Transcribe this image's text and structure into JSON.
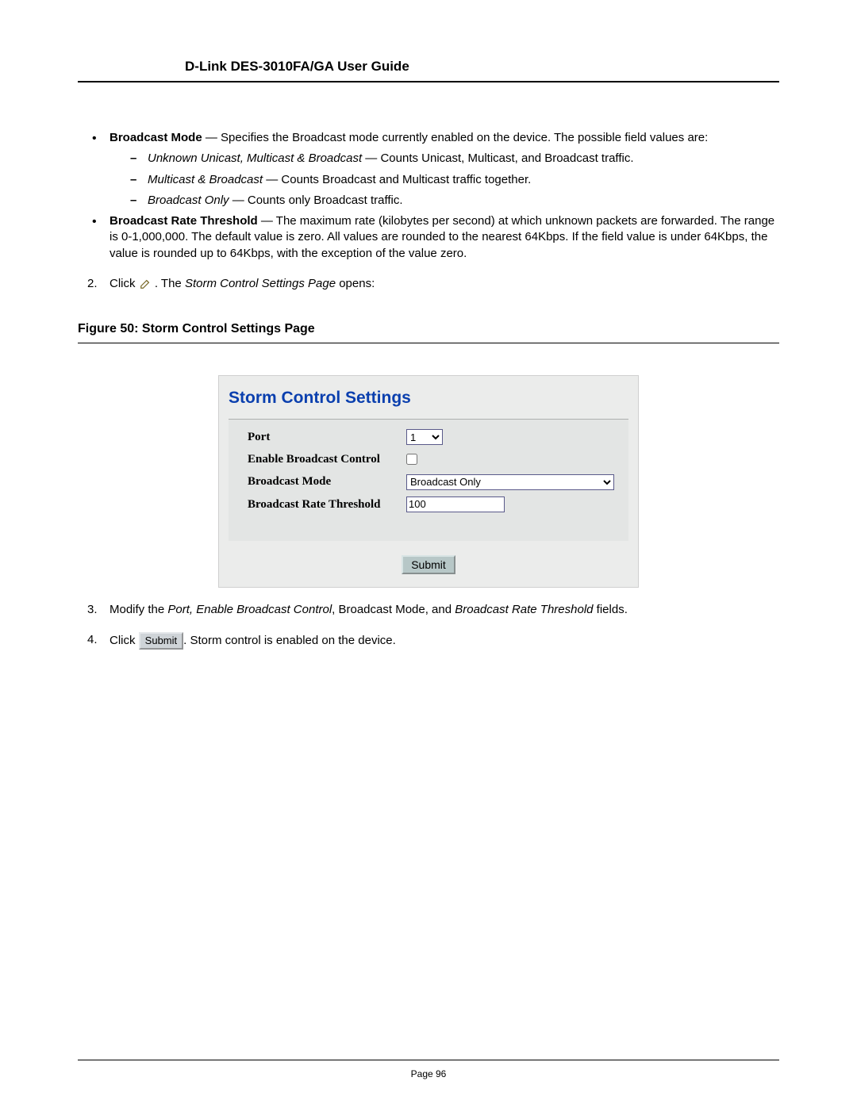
{
  "header": {
    "title": "D-Link DES-3010FA/GA User Guide"
  },
  "bullets": {
    "bm_label": "Broadcast Mode",
    "bm_desc": " — Specifies the Broadcast mode currently enabled on the device. The possible field values are:",
    "sub": [
      {
        "em": "Unknown Unicast, Multicast & Broadcast",
        "rest": " — Counts Unicast, Multicast, and Broadcast traffic."
      },
      {
        "em": "Multicast & Broadcast",
        "rest": " — Counts Broadcast and Multicast traffic together."
      },
      {
        "em": "Broadcast Only",
        "rest": " — Counts only Broadcast traffic."
      }
    ],
    "brt_label": "Broadcast Rate Threshold",
    "brt_desc": " — The maximum rate (kilobytes per second) at which unknown packets are forwarded. The range is 0-1,000,000. The default value is zero. All values are rounded to the nearest 64Kbps. If the field value is under 64Kbps, the value is rounded up to 64Kbps, with the exception of the value zero."
  },
  "step2": {
    "num": "2.",
    "pre": "Click ",
    "mid_em": "Storm Control Settings Page",
    "post": " opens:"
  },
  "figure": {
    "caption": "Figure 50:  Storm Control Settings Page"
  },
  "ui": {
    "title": "Storm Control Settings",
    "rows": {
      "port_label": "Port",
      "port_value": "1",
      "ebc_label": "Enable Broadcast Control",
      "mode_label": "Broadcast Mode",
      "mode_value": "Broadcast Only",
      "brt_label": "Broadcast Rate Threshold",
      "brt_value": "100"
    },
    "submit": "Submit"
  },
  "step3": {
    "num": "3.",
    "t1": "Modify the ",
    "em1": "Port, Enable Broadcast Control",
    "t2": ", Broadcast Mode, and ",
    "em2": "Broadcast Rate Threshold",
    "t3": " fields."
  },
  "step4": {
    "num": "4.",
    "t1": "Click ",
    "btn": "Submit",
    "t2": ". Storm control is enabled on the device."
  },
  "footer": {
    "page": "Page 96"
  }
}
